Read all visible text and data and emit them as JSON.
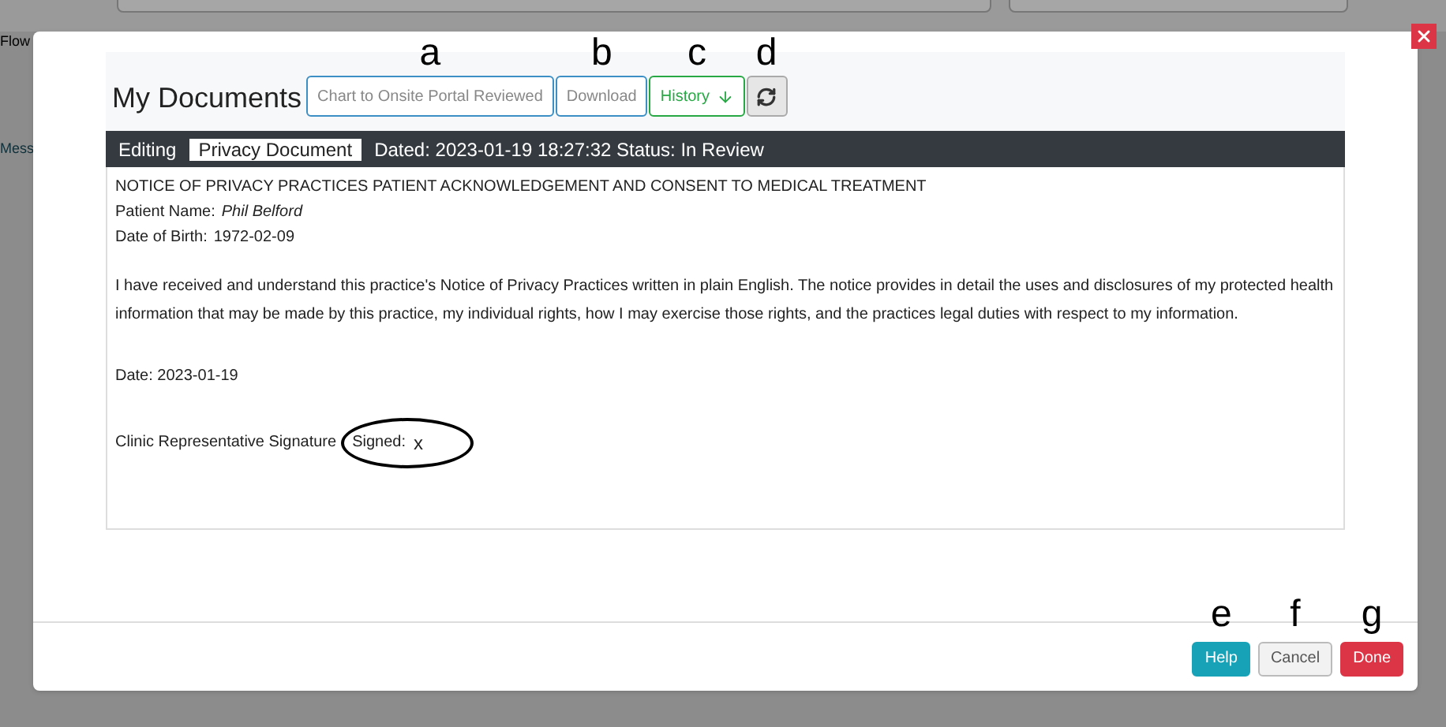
{
  "background": {
    "texts": [
      "Flow",
      "Mess"
    ]
  },
  "modal": {
    "title": "My Documents",
    "toolbar": [
      {
        "kind": "text",
        "label": "Chart to Onsite Portal Reviewed",
        "annotation": "a"
      },
      {
        "kind": "text",
        "label": "Download",
        "annotation": "b"
      },
      {
        "kind": "text",
        "label": "History",
        "annotation": "c"
      },
      {
        "kind": "refresh",
        "annotation": "d"
      }
    ],
    "editing_bar": {
      "prefix": "Editing",
      "document": "Privacy Document",
      "info": "Dated: 2023-01-19 18:27:32 Status: In Review"
    },
    "document": {
      "heading": "NOTICE OF PRIVACY PRACTICES PATIENT ACKNOWLEDGEMENT AND CONSENT TO MEDICAL TREATMENT",
      "patient_label": "Patient Name:",
      "patient_name": "Phil Belford",
      "dob_label": "Date of Birth:",
      "dob": "1972-02-09",
      "paragraph": "I have received and understand this practice's Notice of Privacy Practices written in plain English. The notice provides in detail the uses and disclosures of my protected health information that may be made by this practice, my individual rights, how I may exercise those rights, and the practices legal duties with respect to my information.",
      "date": "Date: 2023-01-19",
      "signature_label": "Clinic Representative Signature",
      "signed_label": "Signed:",
      "signed_mark": "x"
    },
    "footer": [
      {
        "label": "Help",
        "annotation": "e"
      },
      {
        "label": "Cancel",
        "annotation": "f"
      },
      {
        "label": "Done",
        "annotation": "g"
      }
    ]
  }
}
